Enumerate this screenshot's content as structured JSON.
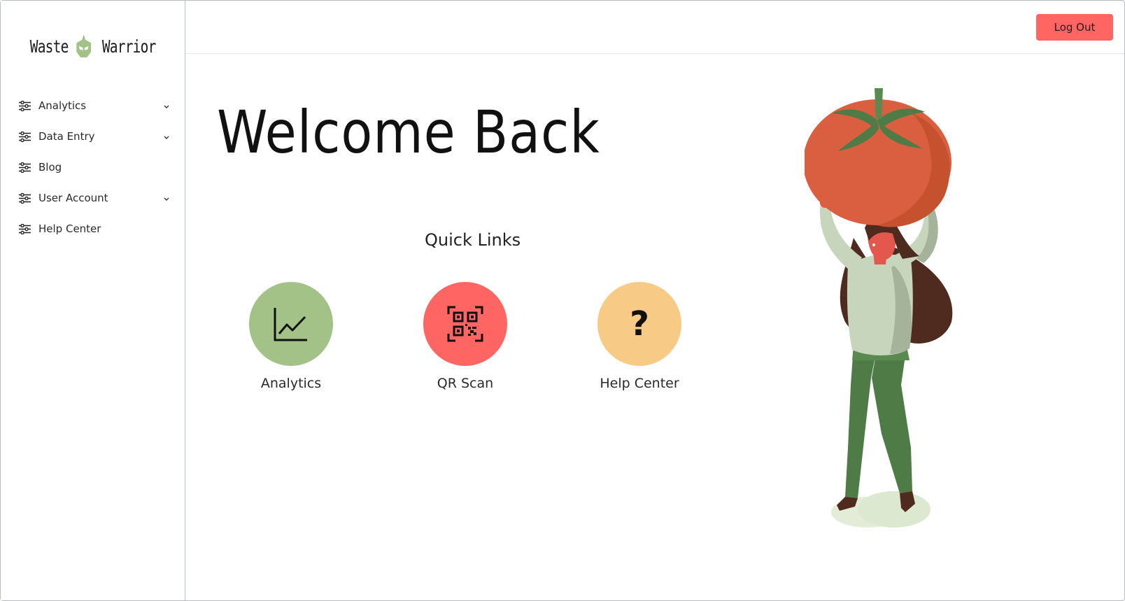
{
  "app": {
    "logo_left": "Waste",
    "logo_right": "Warrior"
  },
  "sidebar": {
    "items": [
      {
        "label": "Analytics",
        "icon": "sliders-icon",
        "has_chevron": true
      },
      {
        "label": "Data Entry",
        "icon": "sliders-icon",
        "has_chevron": true
      },
      {
        "label": "Blog",
        "icon": "sliders-icon",
        "has_chevron": false
      },
      {
        "label": "User Account",
        "icon": "sliders-icon",
        "has_chevron": true
      },
      {
        "label": "Help Center",
        "icon": "sliders-icon",
        "has_chevron": false
      }
    ]
  },
  "header": {
    "logout_label": "Log Out"
  },
  "main": {
    "title": "Welcome Back",
    "quick_links_title": "Quick Links",
    "quick_links": [
      {
        "label": "Analytics",
        "icon": "line-chart-icon",
        "color": "#a3c287"
      },
      {
        "label": "QR Scan",
        "icon": "qr-code-icon",
        "color": "#ff6663"
      },
      {
        "label": "Help Center",
        "icon": "question-mark-icon",
        "glyph": "?",
        "color": "#f7cb86"
      }
    ]
  },
  "colors": {
    "accent_red": "#ff6663",
    "accent_green": "#a3c287",
    "accent_yellow": "#f7cb86",
    "helmet_green": "#a3c287"
  }
}
